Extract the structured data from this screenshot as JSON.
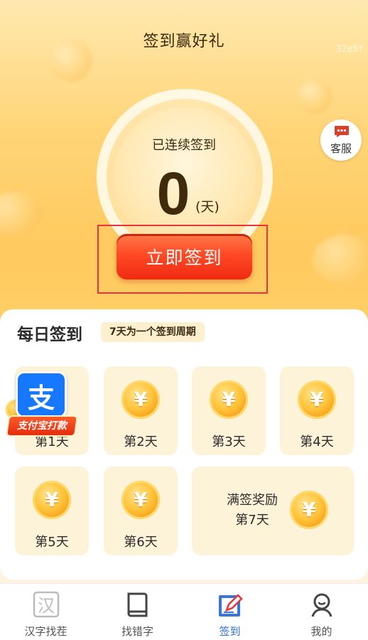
{
  "header": {
    "title": "签到赢好礼",
    "watermark": "32e5f",
    "streak_label": "已连续签到",
    "streak_days": "0",
    "streak_unit": "(天)",
    "customer_service": "客服",
    "sign_in_button": "立即签到"
  },
  "daily": {
    "title": "每日签到",
    "cycle_tag": "7天为一个签到周期",
    "days": [
      {
        "label": "第1天",
        "reward": "alipay-payout"
      },
      {
        "label": "第2天",
        "reward": "coin"
      },
      {
        "label": "第3天",
        "reward": "coin"
      },
      {
        "label": "第4天",
        "reward": "coin"
      },
      {
        "label": "第5天",
        "reward": "coin"
      },
      {
        "label": "第6天",
        "reward": "coin"
      }
    ],
    "full_reward": {
      "line1": "满签奖励",
      "line2": "第7天"
    },
    "coin_symbol": "¥",
    "alipay": {
      "char": "支",
      "banner": "支付宝打款"
    }
  },
  "nav": {
    "items": [
      {
        "label": "汉字找茬",
        "icon": "han-character-icon",
        "active": false
      },
      {
        "label": "找错字",
        "icon": "book-icon",
        "active": false
      },
      {
        "label": "签到",
        "icon": "sign-in-pen-icon",
        "active": true
      },
      {
        "label": "我的",
        "icon": "profile-icon",
        "active": false
      }
    ]
  },
  "colors": {
    "accent_red": "#f02a12",
    "gold": "#ffc43a",
    "active_nav": "#2f6fd6"
  }
}
